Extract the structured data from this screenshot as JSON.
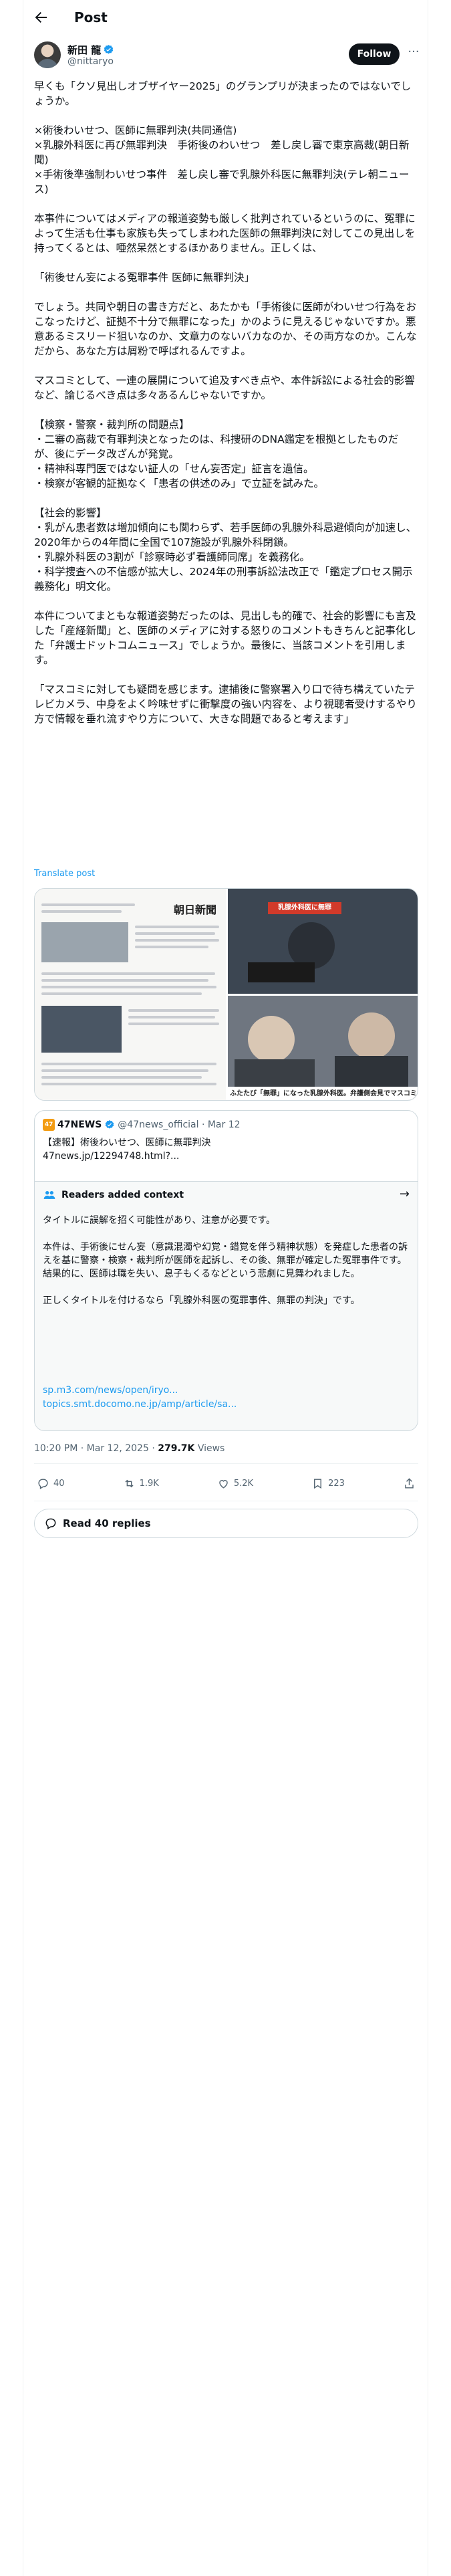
{
  "header": {
    "title": "Post"
  },
  "author": {
    "name": "新田 龍",
    "handle": "@nittaryo",
    "follow_label": "Follow"
  },
  "tweet": {
    "paragraphs": [
      "早くも「クソ見出しオブザイヤー2025」のグランプリが決まったのではないでしょうか。",
      "×術後わいせつ、医師に無罪判決(共同通信)\n×乳腺外科医に再び無罪判決　手術後のわいせつ　差し戻し審で東京高裁(朝日新聞)\n×手術後準強制わいせつ事件　差し戻し審で乳腺外科医に無罪判決(テレ朝ニュース)",
      "本事件についてはメディアの報道姿勢も厳しく批判されているというのに、冤罪によって生活も仕事も家族も失ってしまわれた医師の無罪判決に対してこの見出しを持ってくるとは、唖然呆然とするほかありません。正しくは、",
      "「術後せん妄による冤罪事件 医師に無罪判決」",
      "でしょう。共同や朝日の書き方だと、あたかも「手術後に医師がわいせつ行為をおこなったけど、証拠不十分で無罪になった」かのように見えるじゃないですか。悪意あるミスリード狙いなのか、文章力のないバカなのか、その両方なのか。こんなだから、あなた方は屑粉で呼ばれるんですよ。",
      "マスコミとして、一連の展開について追及すべき点や、本件訴訟による社会的影響など、論じるべき点は多々あるんじゃないですか。",
      "【検察・警察・裁判所の問題点】\n・二審の高裁で有罪判決となったのは、科捜研のDNA鑑定を根拠としたものだが、後にデータ改ざんが発覚。\n・精神科専門医ではない証人の「せん妄否定」証言を過信。\n・検察が客観的証拠なく「患者の供述のみ」で立証を試みた。",
      "【社会的影響】\n・乳がん患者数は増加傾向にも関わらず、若手医師の乳腺外科忌避傾向が加速し、2020年からの4年間に全国で107施設が乳腺外科閉鎖。\n・乳腺外科医の3割が「診察時必ず看護師同席」を義務化。\n・科学捜査への不信感が拡大し、2024年の刑事訴訟法改正で「鑑定プロセス開示義務化」明文化。",
      "本件についてまともな報道姿勢だったのは、見出しも的確で、社会的影響にも言及した「産経新聞」と、医師のメディアに対する怒りのコメントもきちんと記事化した「弁護士ドットコムニュース」でしょうか。最後に、当該コメントを引用します。",
      "「マスコミに対しても疑問を感じます。逮捕後に警察署入り口で待ち構えていたテレビカメラ、中身をよく吟味せずに衝撃度の強い内容を、より視聴者受けするやり方で情報を垂れ流すやり方について、大きな問題であると考えます」"
    ],
    "translate_label": "Translate post"
  },
  "media": {
    "newspaper_logo": "朝日新聞",
    "tv_banner": "乳腺外科医に無罪",
    "photo_caption": "ふたたび「無罪」になった乳腺外科医。弁護側会見でマスコミ"
  },
  "quote": {
    "icon_text": "47",
    "name": "47NEWS",
    "handle": "@47news_official · Mar 12",
    "text_line1": "【速報】術後わいせつ、医師に無罪判決",
    "text_line2": "47news.jp/12294748.html?..."
  },
  "note": {
    "title": "Readers added context",
    "paragraphs": [
      "タイトルに誤解を招く可能性があり、注意が必要です。",
      "本件は、手術後にせん妄（意識混濁や幻覚・錯覚を伴う精神状態）を発症した患者の訴えを基に警察・検察・裁判所が医師を起訴し、その後、無罪が確定した冤罪事件です。\n結果的に、医師は職を失い、息子もくるなどという悲劇に見舞われました。",
      "正しくタイトルを付けるなら「乳腺外科医の冤罪事件、無罪の判決」です。"
    ],
    "link1": "sp.m3.com/news/open/iryo...",
    "link2": "topics.smt.docomo.ne.jp/amp/article/sa..."
  },
  "meta": {
    "time": "10:20 PM · Mar 12, 2025 · ",
    "views_count": "279.7K",
    "views_label": " Views"
  },
  "actions": {
    "replies": "40",
    "reposts": "1.9K",
    "likes": "5.2K",
    "bookmarks": "223"
  },
  "read_replies_label": "Read 40 replies",
  "colors": {
    "accent": "#1d9bf0",
    "text": "#0f1419",
    "muted": "#536471",
    "border": "#cfd9de"
  }
}
